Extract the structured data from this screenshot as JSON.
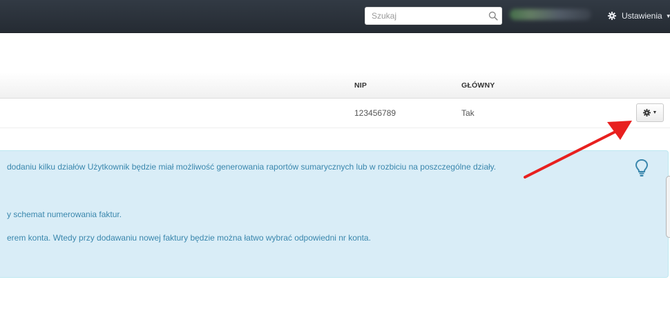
{
  "navbar": {
    "search_placeholder": "Szukaj",
    "settings_label": "Ustawienia"
  },
  "table": {
    "headers": {
      "nip": "NIP",
      "main": "GŁÓWNY"
    },
    "rows": [
      {
        "nip": "123456789",
        "main": "Tak"
      }
    ]
  },
  "info": {
    "lines": [
      "dodaniu kilku działów Użytkownik będzie miał możliwość generowania raportów sumarycznych lub w rozbiciu na poszczególne działy.",
      "y schemat numerowania faktur.",
      "erem konta. Wtedy przy dodawaniu nowej faktury będzie można łatwo wybrać odpowiedni nr konta."
    ]
  },
  "colors": {
    "navbar": "#2b323b",
    "alert_bg": "#d9edf7",
    "alert_text": "#3a87ad",
    "arrow": "#e8201f"
  },
  "icons": [
    "search-icon",
    "gear-icon",
    "chevron-down-icon",
    "lightbulb-icon",
    "arrow-annotation"
  ]
}
